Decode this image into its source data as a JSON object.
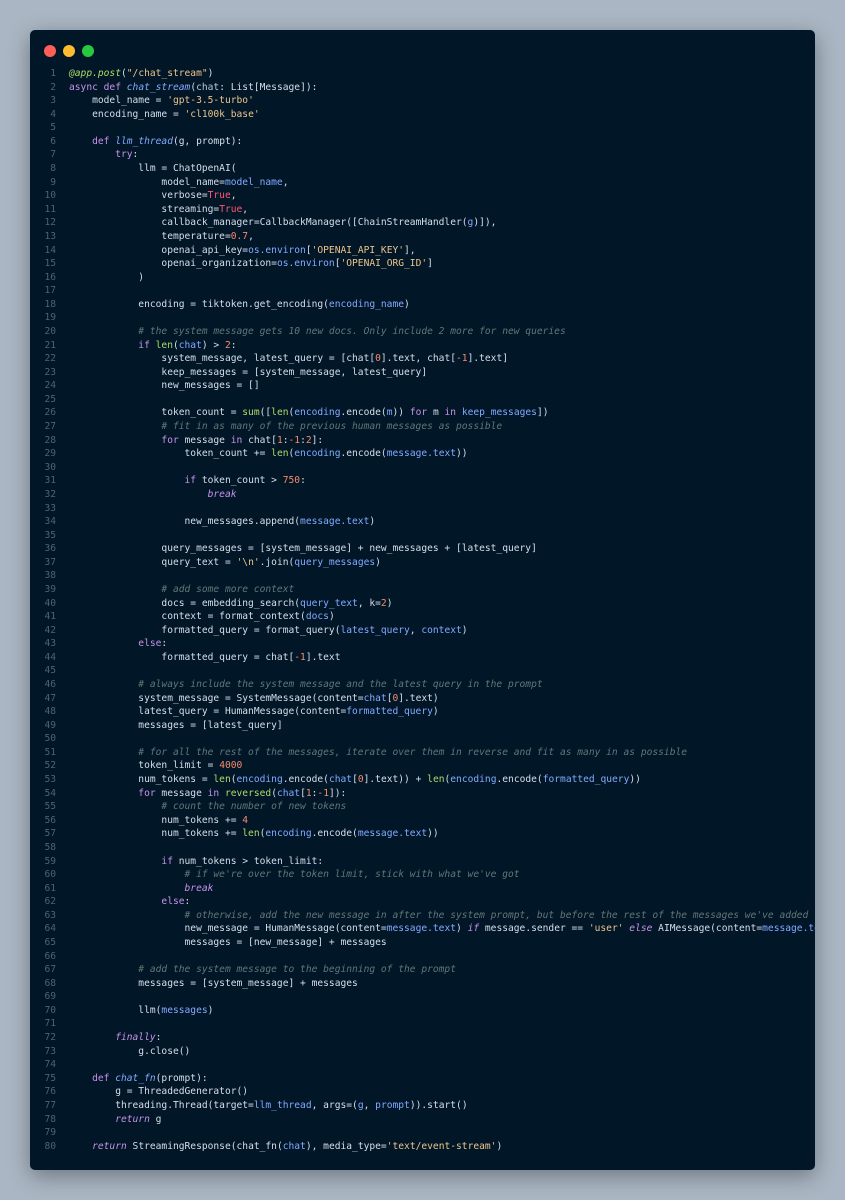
{
  "window": {
    "controls": [
      "close",
      "minimize",
      "maximize"
    ],
    "colors": {
      "background": "#011627",
      "close": "#ff5f57",
      "minimize": "#febc2e",
      "maximize": "#28c840"
    }
  },
  "editor": {
    "language": "python",
    "lines": [
      [
        [
          "d",
          "@app.post"
        ],
        [
          "",
          "("
        ],
        [
          "s",
          "\"/chat_stream\""
        ],
        [
          "",
          ")"
        ]
      ],
      [
        [
          "kn",
          "async "
        ],
        [
          "kn",
          "def "
        ],
        [
          "f",
          "chat_stream"
        ],
        [
          "",
          "("
        ],
        [
          "pa",
          "chat"
        ],
        [
          "",
          ": List[Message]):"
        ]
      ],
      [
        [
          "",
          "    model_name = "
        ],
        [
          "s",
          "'gpt-3.5-turbo'"
        ]
      ],
      [
        [
          "",
          "    encoding_name = "
        ],
        [
          "s",
          "'cl100k_base'"
        ]
      ],
      [],
      [
        [
          "kn",
          "    def "
        ],
        [
          "f",
          "llm_thread"
        ],
        [
          "",
          "(g, prompt):"
        ]
      ],
      [
        [
          "kn",
          "        try"
        ],
        [
          "",
          ":"
        ]
      ],
      [
        [
          "",
          "            llm = ChatOpenAI("
        ]
      ],
      [
        [
          "",
          "                model_name="
        ],
        [
          "fn",
          "model_name"
        ],
        [
          "",
          ","
        ]
      ],
      [
        [
          "",
          "                verbose="
        ],
        [
          "b",
          "True"
        ],
        [
          "",
          ","
        ]
      ],
      [
        [
          "",
          "                streaming="
        ],
        [
          "b",
          "True"
        ],
        [
          "",
          ","
        ]
      ],
      [
        [
          "",
          "                callback_manager=CallbackManager([ChainStreamHandler("
        ],
        [
          "fn",
          "g"
        ],
        [
          "",
          ")]),"
        ]
      ],
      [
        [
          "",
          "                temperature="
        ],
        [
          "n",
          "0.7"
        ],
        [
          "",
          ","
        ]
      ],
      [
        [
          "",
          "                openai_api_key="
        ],
        [
          "fn",
          "os.environ"
        ],
        [
          "",
          "["
        ],
        [
          "s",
          "'OPENAI_API_KEY'"
        ],
        [
          "",
          "],"
        ]
      ],
      [
        [
          "",
          "                openai_organization="
        ],
        [
          "fn",
          "os.environ"
        ],
        [
          "",
          "["
        ],
        [
          "s",
          "'OPENAI_ORG_ID'"
        ],
        [
          "",
          "]"
        ]
      ],
      [
        [
          "",
          "            )"
        ]
      ],
      [],
      [
        [
          "",
          "            encoding = tiktoken.get_encoding("
        ],
        [
          "fn",
          "encoding_name"
        ],
        [
          "",
          ")"
        ]
      ],
      [],
      [
        [
          "c",
          "            # the system message gets 10 new docs. Only include 2 more for new queries"
        ]
      ],
      [
        [
          "kn",
          "            if "
        ],
        [
          "bi",
          "len"
        ],
        [
          "",
          "("
        ],
        [
          "fn",
          "chat"
        ],
        [
          "",
          ") > "
        ],
        [
          "n",
          "2"
        ],
        [
          "",
          ":"
        ]
      ],
      [
        [
          "",
          "                system_message, latest_query = [chat["
        ],
        [
          "n",
          "0"
        ],
        [
          "",
          "].text, chat["
        ],
        [
          "n",
          "-1"
        ],
        [
          "",
          "].text]"
        ]
      ],
      [
        [
          "",
          "                keep_messages = [system_message, latest_query]"
        ]
      ],
      [
        [
          "",
          "                new_messages = []"
        ]
      ],
      [],
      [
        [
          "",
          "                token_count = "
        ],
        [
          "bi",
          "sum"
        ],
        [
          "",
          "(["
        ],
        [
          "bi",
          "len"
        ],
        [
          "",
          "("
        ],
        [
          "fn",
          "encoding"
        ],
        [
          "",
          ".encode("
        ],
        [
          "fn",
          "m"
        ],
        [
          "",
          "))"
        ],
        [
          "kn",
          " for "
        ],
        [
          "",
          "m "
        ],
        [
          "kn",
          "in "
        ],
        [
          "fn",
          "keep_messages"
        ],
        [
          "",
          "])"
        ]
      ],
      [
        [
          "c",
          "                # fit in as many of the previous human messages as possible"
        ]
      ],
      [
        [
          "kn",
          "                for "
        ],
        [
          "",
          "message "
        ],
        [
          "kn",
          "in "
        ],
        [
          "",
          "chat["
        ],
        [
          "n",
          "1"
        ],
        [
          "",
          ":"
        ],
        [
          "n",
          "-1"
        ],
        [
          "",
          ":"
        ],
        [
          "n",
          "2"
        ],
        [
          "",
          "]:"
        ]
      ],
      [
        [
          "",
          "                    token_count += "
        ],
        [
          "bi",
          "len"
        ],
        [
          "",
          "("
        ],
        [
          "fn",
          "encoding"
        ],
        [
          "",
          ".encode("
        ],
        [
          "fn",
          "message.text"
        ],
        [
          "",
          "))"
        ]
      ],
      [],
      [
        [
          "kn",
          "                    if "
        ],
        [
          "",
          "token_count > "
        ],
        [
          "n",
          "750"
        ],
        [
          "",
          ":"
        ]
      ],
      [
        [
          "k",
          "                        break"
        ]
      ],
      [],
      [
        [
          "",
          "                    new_messages.append("
        ],
        [
          "fn",
          "message.text"
        ],
        [
          "",
          ")"
        ]
      ],
      [],
      [
        [
          "",
          "                query_messages = [system_message] + new_messages + [latest_query]"
        ]
      ],
      [
        [
          "",
          "                query_text = "
        ],
        [
          "s",
          "'\\n'"
        ],
        [
          "",
          ".join("
        ],
        [
          "fn",
          "query_messages"
        ],
        [
          "",
          ")"
        ]
      ],
      [],
      [
        [
          "c",
          "                # add some more context"
        ]
      ],
      [
        [
          "",
          "                docs = embedding_search("
        ],
        [
          "fn",
          "query_text"
        ],
        [
          "",
          ", k="
        ],
        [
          "n",
          "2"
        ],
        [
          "",
          ")"
        ]
      ],
      [
        [
          "",
          "                context = format_context("
        ],
        [
          "fn",
          "docs"
        ],
        [
          "",
          ")"
        ]
      ],
      [
        [
          "",
          "                formatted_query = format_query("
        ],
        [
          "fn",
          "latest_query"
        ],
        [
          "",
          ", "
        ],
        [
          "fn",
          "context"
        ],
        [
          "",
          ")"
        ]
      ],
      [
        [
          "kn",
          "            else"
        ],
        [
          "",
          ":"
        ]
      ],
      [
        [
          "",
          "                formatted_query = chat["
        ],
        [
          "n",
          "-1"
        ],
        [
          "",
          "].text"
        ]
      ],
      [],
      [
        [
          "c",
          "            # always include the system message and the latest query in the prompt"
        ]
      ],
      [
        [
          "",
          "            system_message = SystemMessage(content="
        ],
        [
          "fn",
          "chat"
        ],
        [
          "",
          "["
        ],
        [
          "n",
          "0"
        ],
        [
          "",
          "].text)"
        ]
      ],
      [
        [
          "",
          "            latest_query = HumanMessage(content="
        ],
        [
          "fn",
          "formatted_query"
        ],
        [
          "",
          ")"
        ]
      ],
      [
        [
          "",
          "            messages = [latest_query]"
        ]
      ],
      [],
      [
        [
          "c",
          "            # for all the rest of the messages, iterate over them in reverse and fit as many in as possible"
        ]
      ],
      [
        [
          "",
          "            token_limit = "
        ],
        [
          "n",
          "4000"
        ]
      ],
      [
        [
          "",
          "            num_tokens = "
        ],
        [
          "bi",
          "len"
        ],
        [
          "",
          "("
        ],
        [
          "fn",
          "encoding"
        ],
        [
          "",
          ".encode("
        ],
        [
          "fn",
          "chat"
        ],
        [
          "",
          "["
        ],
        [
          "n",
          "0"
        ],
        [
          "",
          "].text)) + "
        ],
        [
          "bi",
          "len"
        ],
        [
          "",
          "("
        ],
        [
          "fn",
          "encoding"
        ],
        [
          "",
          ".encode("
        ],
        [
          "fn",
          "formatted_query"
        ],
        [
          "",
          "))"
        ]
      ],
      [
        [
          "kn",
          "            for "
        ],
        [
          "",
          "message "
        ],
        [
          "kn",
          "in "
        ],
        [
          "bi",
          "reversed"
        ],
        [
          "",
          "("
        ],
        [
          "fn",
          "chat"
        ],
        [
          "",
          "["
        ],
        [
          "n",
          "1"
        ],
        [
          "",
          ":"
        ],
        [
          "n",
          "-1"
        ],
        [
          "",
          "]):"
        ]
      ],
      [
        [
          "c",
          "                # count the number of new tokens"
        ]
      ],
      [
        [
          "",
          "                num_tokens += "
        ],
        [
          "n",
          "4"
        ]
      ],
      [
        [
          "",
          "                num_tokens += "
        ],
        [
          "bi",
          "len"
        ],
        [
          "",
          "("
        ],
        [
          "fn",
          "encoding"
        ],
        [
          "",
          ".encode("
        ],
        [
          "fn",
          "message.text"
        ],
        [
          "",
          "))"
        ]
      ],
      [],
      [
        [
          "kn",
          "                if "
        ],
        [
          "",
          "num_tokens > token_limit:"
        ]
      ],
      [
        [
          "c",
          "                    # if we're over the token limit, stick with what we've got"
        ]
      ],
      [
        [
          "k",
          "                    break"
        ]
      ],
      [
        [
          "kn",
          "                else"
        ],
        [
          "",
          ":"
        ]
      ],
      [
        [
          "c",
          "                    # otherwise, add the new message in after the system prompt, but before the rest of the messages we've added"
        ]
      ],
      [
        [
          "",
          "                    new_message = HumanMessage(content="
        ],
        [
          "fn",
          "message.text"
        ],
        [
          "",
          ") "
        ],
        [
          "k",
          "if "
        ],
        [
          "",
          "message.sender == "
        ],
        [
          "s",
          "'user'"
        ],
        [
          "k",
          " else "
        ],
        [
          "",
          "AIMessage(content="
        ],
        [
          "fn",
          "message.text"
        ],
        [
          "",
          ")"
        ]
      ],
      [
        [
          "",
          "                    messages = [new_message] + messages"
        ]
      ],
      [],
      [
        [
          "c",
          "            # add the system message to the beginning of the prompt"
        ]
      ],
      [
        [
          "",
          "            messages = [system_message] + messages"
        ]
      ],
      [],
      [
        [
          "",
          "            llm("
        ],
        [
          "fn",
          "messages"
        ],
        [
          "",
          ")"
        ]
      ],
      [],
      [
        [
          "k",
          "        finally"
        ],
        [
          "",
          ":"
        ]
      ],
      [
        [
          "",
          "            g.close()"
        ]
      ],
      [],
      [
        [
          "kn",
          "    def "
        ],
        [
          "f",
          "chat_fn"
        ],
        [
          "",
          "(prompt):"
        ]
      ],
      [
        [
          "",
          "        g = ThreadedGenerator()"
        ]
      ],
      [
        [
          "",
          "        threading.Thread(target="
        ],
        [
          "fn",
          "llm_thread"
        ],
        [
          "",
          ", args=("
        ],
        [
          "fn",
          "g"
        ],
        [
          "",
          ", "
        ],
        [
          "fn",
          "prompt"
        ],
        [
          "",
          "))"
        ],
        [
          "",
          ".start()"
        ]
      ],
      [
        [
          "k",
          "        return "
        ],
        [
          "",
          "g"
        ]
      ],
      [],
      [
        [
          "k",
          "    return "
        ],
        [
          "",
          "StreamingResponse(chat_fn("
        ],
        [
          "fn",
          "chat"
        ],
        [
          "",
          "), media_type="
        ],
        [
          "s",
          "'text/event-stream'"
        ],
        [
          "",
          ")"
        ]
      ]
    ]
  }
}
